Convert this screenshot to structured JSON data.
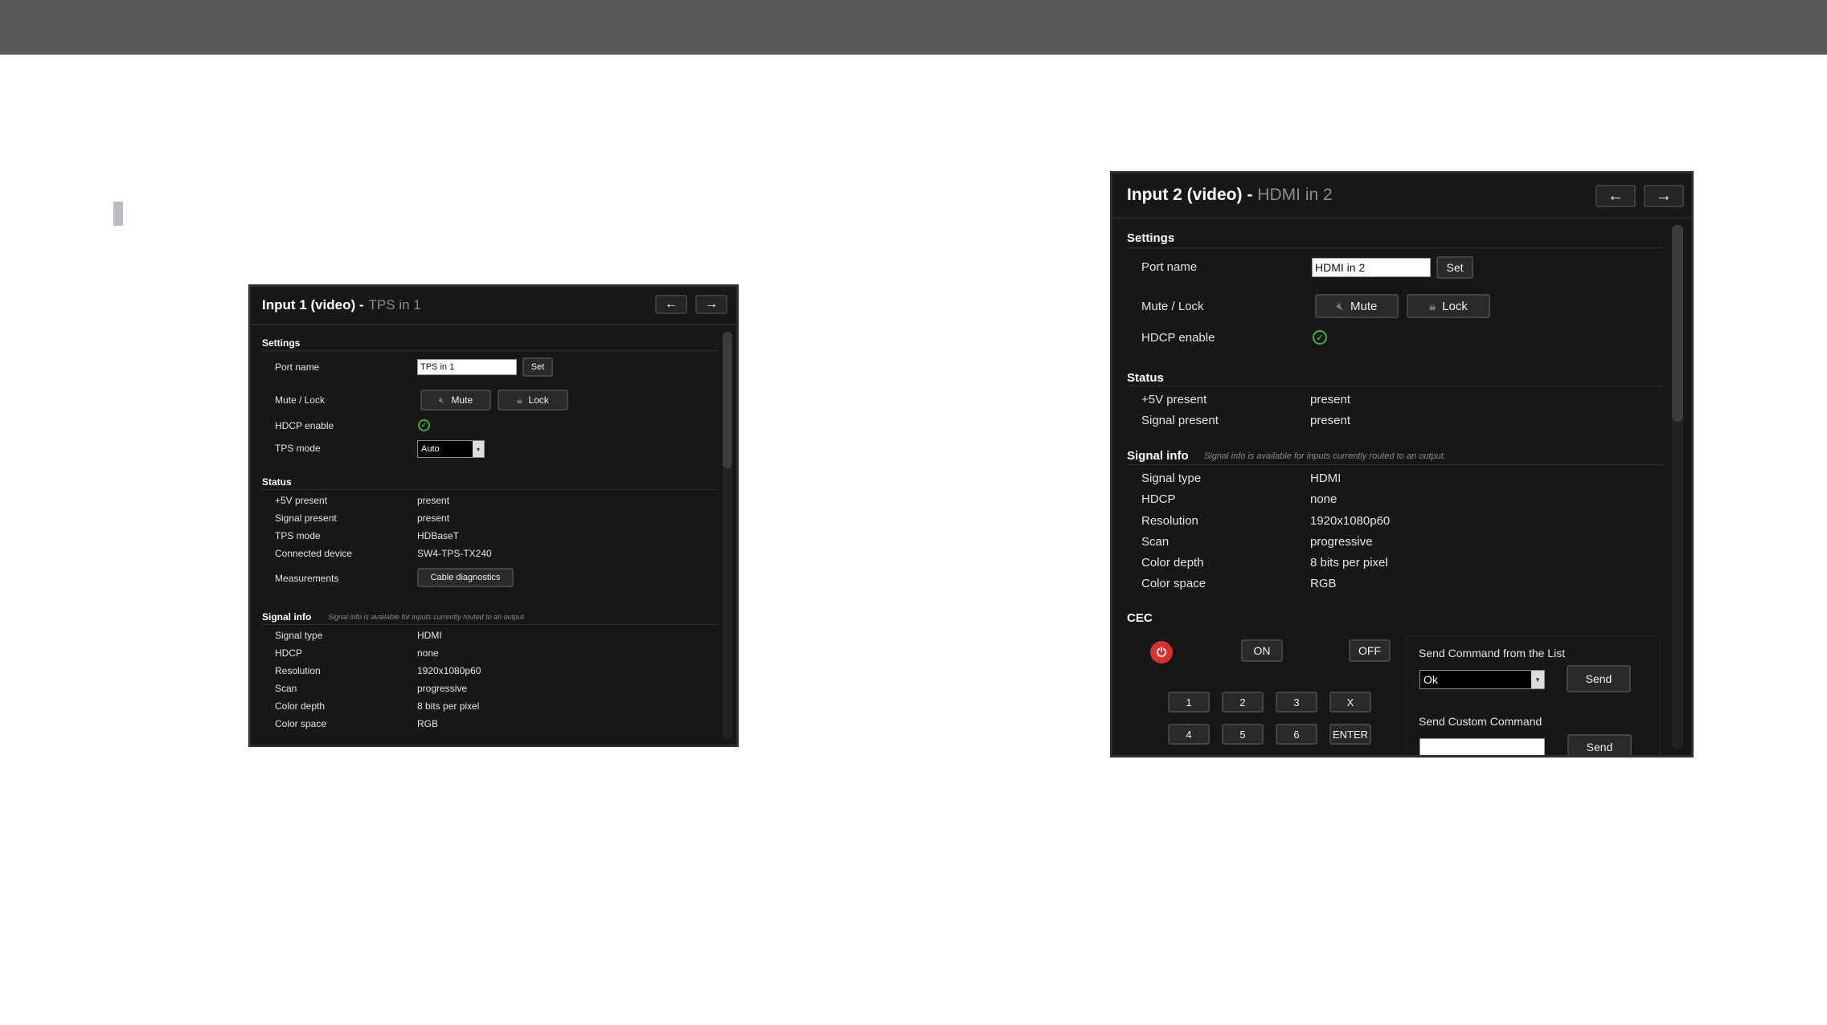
{
  "colors": {
    "topbar": "#58595b",
    "panel_bg": "#171717",
    "title_sub": "#8c8c8c",
    "check": "#3fae3f",
    "power": "#d93030"
  },
  "panel1": {
    "title": "Input 1 (video) -",
    "subtitle": "TPS in 1",
    "nav_prev": "←",
    "nav_next": "→",
    "settings": {
      "heading": "Settings",
      "port_name_label": "Port name",
      "port_name_value": "TPS in 1",
      "set_label": "Set",
      "mute_lock_label": "Mute / Lock",
      "mute_label": "Mute",
      "lock_label": "Lock",
      "hdcp_label": "HDCP enable",
      "hdcp_icon": "check-circle-icon",
      "tps_mode_label": "TPS mode",
      "tps_mode_value": "Auto"
    },
    "status": {
      "heading": "Status",
      "rows": [
        {
          "label": "+5V present",
          "value": "present"
        },
        {
          "label": "Signal present",
          "value": "present"
        },
        {
          "label": "TPS mode",
          "value": "HDBaseT"
        },
        {
          "label": "Connected device",
          "value": "SW4-TPS-TX240"
        }
      ],
      "measurements_label": "Measurements",
      "cable_diag_label": "Cable diagnostics"
    },
    "signal_info": {
      "heading": "Signal info",
      "note": "Signal info is available for inputs currently routed to an output.",
      "rows": [
        {
          "label": "Signal type",
          "value": "HDMI"
        },
        {
          "label": "HDCP",
          "value": "none"
        },
        {
          "label": "Resolution",
          "value": "1920x1080p60"
        },
        {
          "label": "Scan",
          "value": "progressive"
        },
        {
          "label": "Color depth",
          "value": "8 bits per pixel"
        },
        {
          "label": "Color space",
          "value": "RGB"
        }
      ]
    }
  },
  "panel2": {
    "title": "Input 2 (video) -",
    "subtitle": "HDMI in 2",
    "nav_prev": "←",
    "nav_next": "→",
    "settings": {
      "heading": "Settings",
      "port_name_label": "Port name",
      "port_name_value": "HDMI in 2",
      "set_label": "Set",
      "mute_lock_label": "Mute / Lock",
      "mute_label": "Mute",
      "lock_label": "Lock",
      "hdcp_label": "HDCP enable",
      "hdcp_icon": "check-circle-icon"
    },
    "status": {
      "heading": "Status",
      "rows": [
        {
          "label": "+5V present",
          "value": "present"
        },
        {
          "label": "Signal present",
          "value": "present"
        }
      ]
    },
    "signal_info": {
      "heading": "Signal info",
      "note": "Signal info is available for inputs currently routed to an output.",
      "rows": [
        {
          "label": "Signal type",
          "value": "HDMI"
        },
        {
          "label": "HDCP",
          "value": "none"
        },
        {
          "label": "Resolution",
          "value": "1920x1080p60"
        },
        {
          "label": "Scan",
          "value": "progressive"
        },
        {
          "label": "Color depth",
          "value": "8 bits per pixel"
        },
        {
          "label": "Color space",
          "value": "RGB"
        }
      ]
    },
    "cec": {
      "heading": "CEC",
      "power_icon": "power-icon",
      "on_label": "ON",
      "off_label": "OFF",
      "keys_row1": [
        "1",
        "2",
        "3",
        "X"
      ],
      "keys_row2": [
        "4",
        "5",
        "6",
        "ENTER"
      ],
      "send_list_heading": "Send Command from the List",
      "send_list_value": "Ok",
      "send_label": "Send",
      "send_custom_heading": "Send Custom Command",
      "send_custom_value": "",
      "send_custom_label": "Send"
    }
  }
}
